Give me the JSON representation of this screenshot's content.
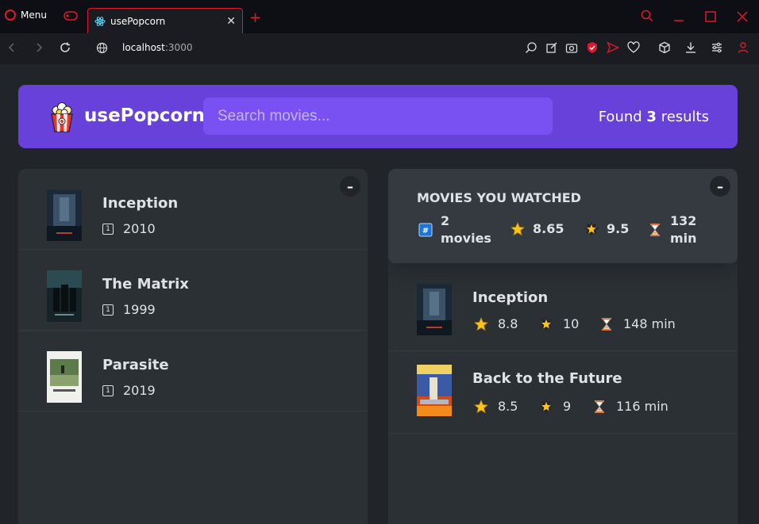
{
  "browser": {
    "menu_label": "Menu",
    "tab_title": "usePopcorn",
    "url_host": "localhost",
    "url_rest": ":3000",
    "colors": {
      "accent": "#e0172f",
      "chrome_bg": "#0e0f14"
    }
  },
  "app": {
    "logo_text": "usePopcorn",
    "search_placeholder": "Search movies...",
    "results_prefix": "Found",
    "results_count": "3",
    "results_suffix": "results",
    "colors": {
      "primary": "#6741d9",
      "primary_light": "#7950f2",
      "background": "#212529",
      "box": "#2b3035"
    }
  },
  "search_results": [
    {
      "title": "Inception",
      "year": "2010",
      "poster": "inception-poster"
    },
    {
      "title": "The Matrix",
      "year": "1999",
      "poster": "matrix-poster"
    },
    {
      "title": "Parasite",
      "year": "2019",
      "poster": "parasite-poster"
    }
  ],
  "summary": {
    "heading": "MOVIES YOU WATCHED",
    "count_value": "2",
    "count_unit": "movies",
    "avg_imdb": "8.65",
    "avg_user": "9.5",
    "avg_runtime_value": "132",
    "avg_runtime_unit": "min"
  },
  "watched": [
    {
      "title": "Inception",
      "imdb": "8.8",
      "user": "10",
      "runtime": "148 min",
      "poster": "inception-poster"
    },
    {
      "title": "Back to the Future",
      "imdb": "8.5",
      "user": "9",
      "runtime": "116 min",
      "poster": "back-to-the-future-poster"
    }
  ],
  "toggle_label": "–"
}
